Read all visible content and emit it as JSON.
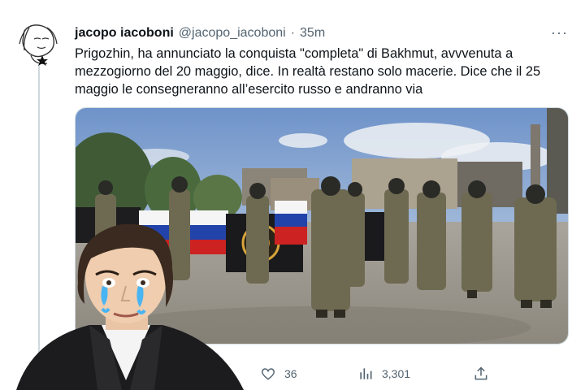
{
  "tweet": {
    "display_name": "jacopo iacoboni",
    "handle": "@jacopo_iacoboni",
    "separator": "·",
    "time": "35m",
    "more_label": "···",
    "text": "Prigozhin, ha annunciato la conquista \"completa\" di Bakhmut, avvvenuta a mezzogiorno del 20 maggio, dice. In realtà restano solo macerie. Dice che il 25 maggio le consegneranno all’esercito russo e andranno via",
    "media_alt": "photo"
  },
  "actions": {
    "likes": "36",
    "views": "3,301"
  },
  "icons": {
    "like": "heart-icon",
    "views": "bar-chart-icon",
    "share": "share-icon",
    "more": "more-icon"
  },
  "colors": {
    "text_primary": "#0f1419",
    "text_secondary": "#536471",
    "divider": "#cfd9de"
  }
}
